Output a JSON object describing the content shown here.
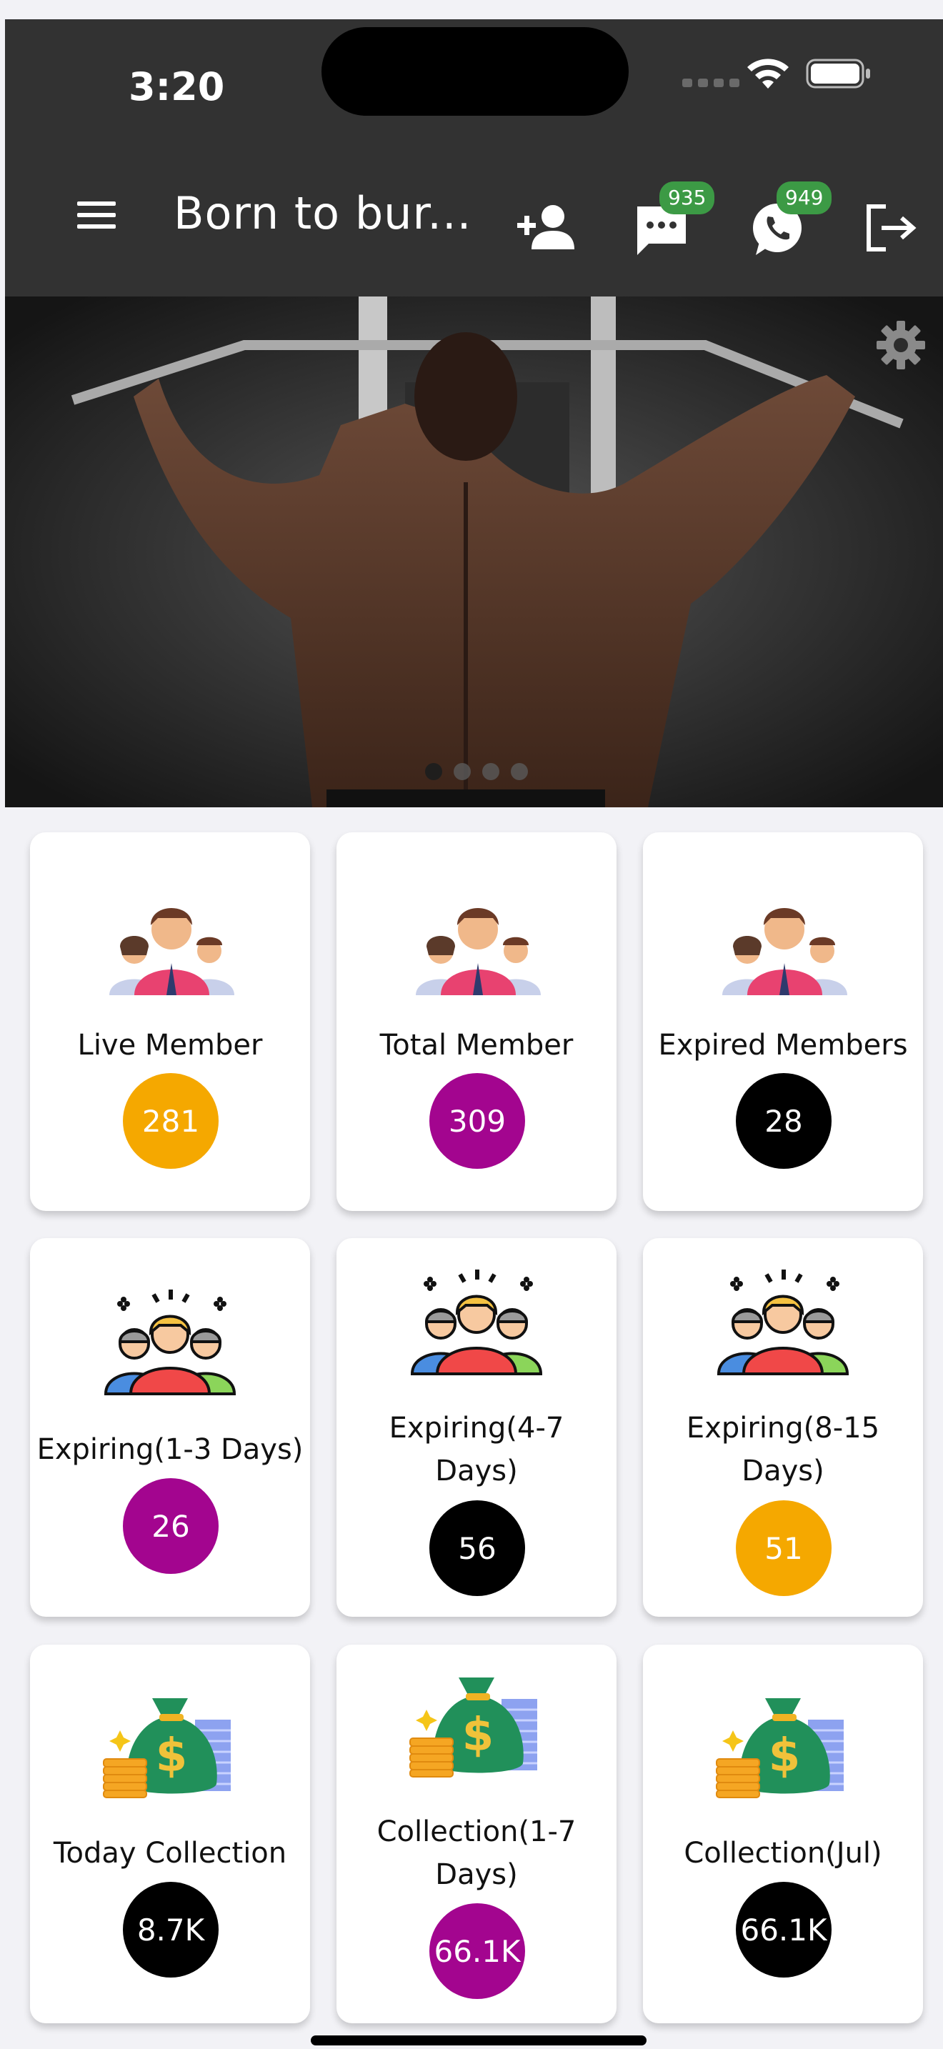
{
  "status_bar": {
    "time": "3:20"
  },
  "appbar": {
    "title": "Born to bur...",
    "sms_badge": "935",
    "whatsapp_badge": "949"
  },
  "banner": {
    "slides": 4,
    "active_slide": 1
  },
  "cards": [
    {
      "label": "Live Member",
      "value": "281",
      "color": "#f5a800",
      "icon": "members-group-icon"
    },
    {
      "label": "Total Member",
      "value": "309",
      "color": "#a3058f",
      "icon": "members-group-icon"
    },
    {
      "label": "Expired Members",
      "value": "28",
      "color": "#000000",
      "icon": "members-group-icon"
    },
    {
      "label": "Expiring(1-3 Days)",
      "value": "26",
      "color": "#a3058f",
      "icon": "alert-group-icon"
    },
    {
      "label_line1": "Expiring(4-7",
      "label_line2": "Days)",
      "value": "56",
      "color": "#000000",
      "icon": "alert-group-icon"
    },
    {
      "label_line1": "Expiring(8-15",
      "label_line2": "Days)",
      "value": "51",
      "color": "#f5a800",
      "icon": "alert-group-icon"
    },
    {
      "label": "Today Collection",
      "value": "8.7K",
      "color": "#000000",
      "icon": "money-bag-icon"
    },
    {
      "label_line1": "Collection(1-7",
      "label_line2": "Days)",
      "value": "66.1K",
      "color": "#a3058f",
      "icon": "money-bag-icon"
    },
    {
      "label": "Collection(Jul)",
      "value": "66.1K",
      "color": "#000000",
      "icon": "money-bag-icon"
    }
  ]
}
